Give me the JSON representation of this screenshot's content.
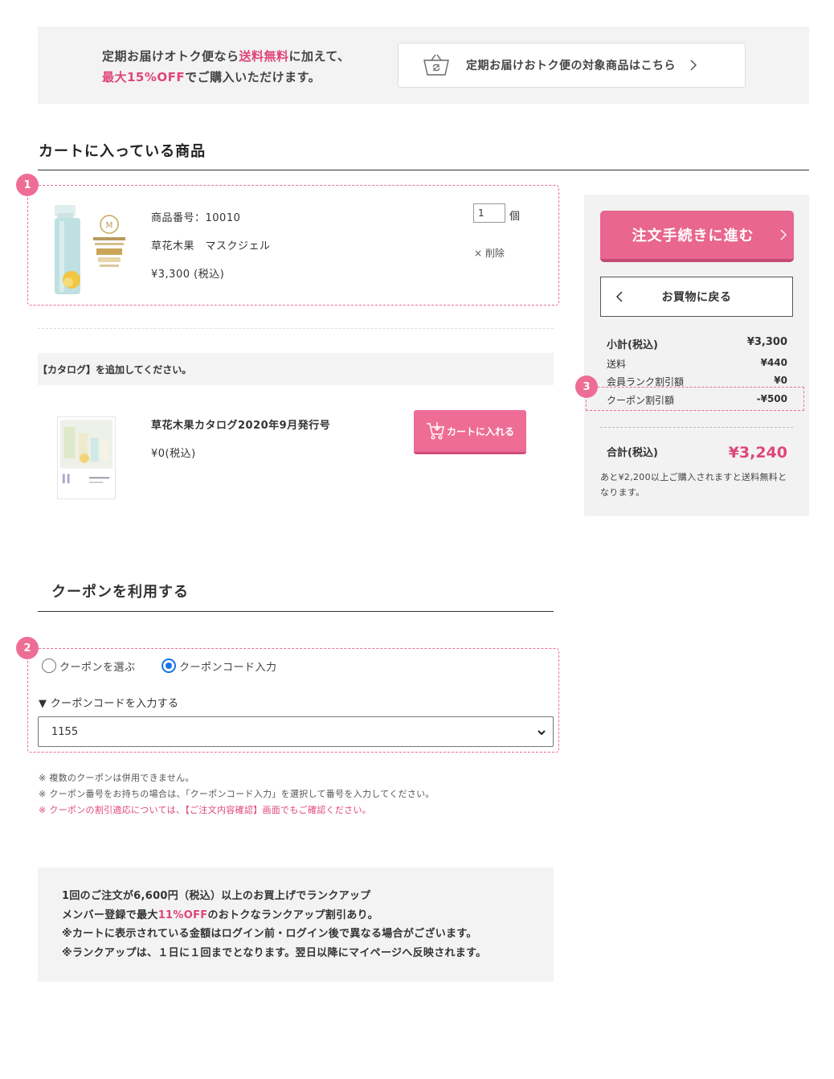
{
  "banner": {
    "line1_a": "定期お届けオトク便なら",
    "line1_b": "送料無料",
    "line1_c": "に加えて、",
    "line2_a": "最大15%OFF",
    "line2_b": "でご購入いただけます。",
    "link_label": "定期お届けおトク便の対象商品はこちら"
  },
  "cart": {
    "title": "カートに入っている商品",
    "marker": "1",
    "item": {
      "product_no": "商品番号：10010",
      "name": "草花木果　マスクジェル",
      "price": "¥3,300 (税込)",
      "quantity": "1",
      "unit": "個",
      "delete": "× 削除"
    }
  },
  "catalog": {
    "header": "【カタログ】を追加してください。",
    "name": "草花木果カタログ2020年9月発行号",
    "price": "¥0(税込)",
    "add_button": "カートに入れる"
  },
  "coupon": {
    "title": "クーポンを利用する",
    "marker": "2",
    "option_select": "クーポンを選ぶ",
    "option_code": "クーポンコード入力",
    "code_label": "▼ クーポンコードを入力する",
    "selected_value": "1155",
    "note1": "※ 複数のクーポンは併用できません。",
    "note2": "※ クーポン番号をお持ちの場合は、「クーポンコード入力」を選択して番号を入力してください。",
    "note3": "※ クーポンの割引適応については、【ご注文内容確認】画面でもご確認ください。"
  },
  "rank": {
    "line1": "1回のご注文が6,600円（税込）以上のお買上げでランクアップ",
    "line2_a": "メンバー登録で最大",
    "line2_b": "11%OFF",
    "line2_c": "のおトクなランクアップ割引あり。",
    "line3": "※カートに表示されている金額はログイン前・ログイン後で異なる場合がございます。",
    "line4": "※ランクアップは、１日に１回までとなります。翌日以降にマイページへ反映されます。"
  },
  "summary": {
    "order_button": "注文手続きに進む",
    "back_button": "お買物に戻る",
    "marker": "3",
    "subtotal_label": "小計(税込)",
    "subtotal_value": "¥3,300",
    "shipping_label": "送料",
    "shipping_value": "¥440",
    "rank_discount_label": "会員ランク割引額",
    "rank_discount_value": "¥0",
    "coupon_discount_label": "クーポン割引額",
    "coupon_discount_value": "-¥500",
    "total_label": "合計(税込)",
    "total_value": "¥3,240",
    "shipping_note": "あと¥2,200以上ご購入されますと送料無料となります。"
  },
  "colors": {
    "accent": "#e0457b",
    "button_pink": "#e8668f",
    "panel_gray": "#f2f2f2"
  }
}
